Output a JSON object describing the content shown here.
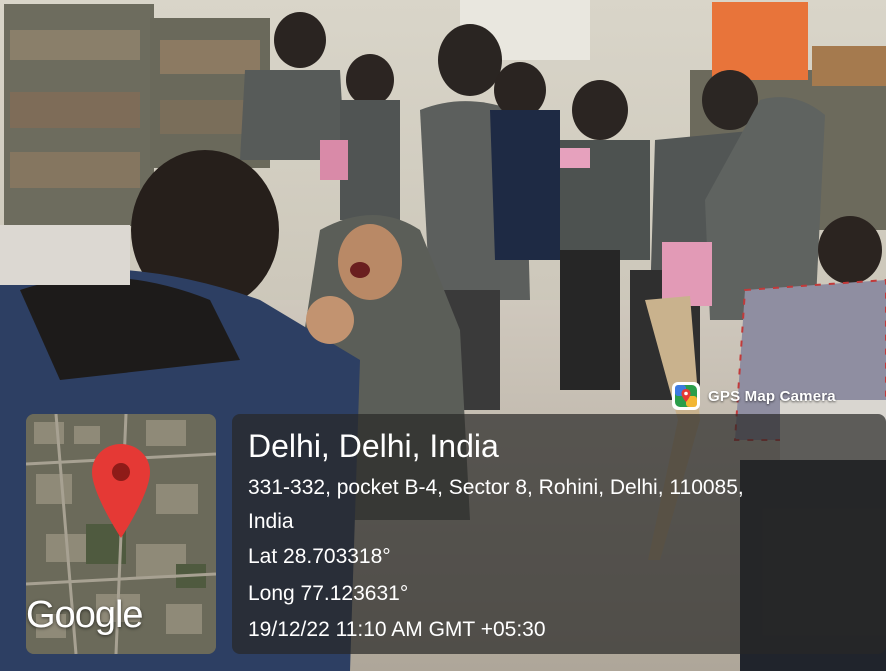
{
  "badge": {
    "app_name": "GPS Map Camera",
    "icon": "gps-map-camera-icon"
  },
  "map": {
    "brand": "Google",
    "pin_icon": "map-pin-icon",
    "pin_color": "#e53935"
  },
  "location": {
    "title": "Delhi, Delhi, India",
    "address_line1": "331-332, pocket B-4, Sector 8, Rohini, Delhi, 110085,",
    "address_line2": "India",
    "lat": "Lat 28.703318°",
    "long": "Long 77.123631°",
    "timestamp": "19/12/22 11:10 AM GMT +05:30"
  }
}
